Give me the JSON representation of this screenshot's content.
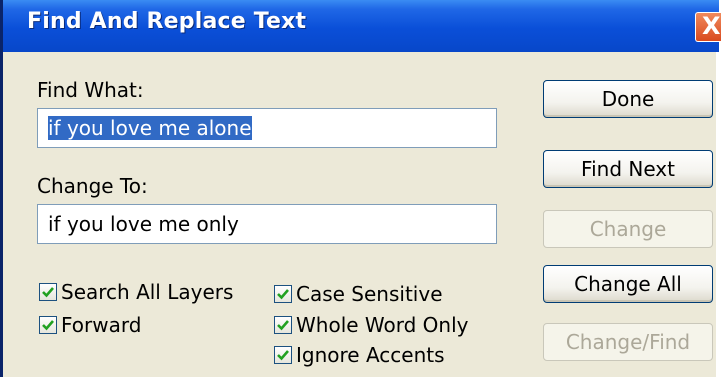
{
  "window": {
    "title": "Find And Replace Text",
    "close_glyph": "X"
  },
  "find": {
    "label": "Find What:",
    "value": "if you love me alone"
  },
  "change": {
    "label": "Change To:",
    "value": "if you love me only"
  },
  "buttons": {
    "done": "Done",
    "find_next": "Find Next",
    "change": "Change",
    "change_all": "Change All",
    "change_find": "Change/Find"
  },
  "options": {
    "search_all_layers": {
      "label": "Search All Layers",
      "checked": true
    },
    "forward": {
      "label": "Forward",
      "checked": true
    },
    "case_sensitive": {
      "label": "Case Sensitive",
      "checked": true
    },
    "whole_word_only": {
      "label": "Whole Word Only",
      "checked": true
    },
    "ignore_accents": {
      "label": "Ignore Accents",
      "checked": true
    }
  },
  "colors": {
    "titlebar": "#0a4fd8",
    "dialog_bg": "#ece9d8",
    "selection": "#316ac5",
    "check_mark": "#21a121",
    "close_button": "#d94a1f"
  }
}
